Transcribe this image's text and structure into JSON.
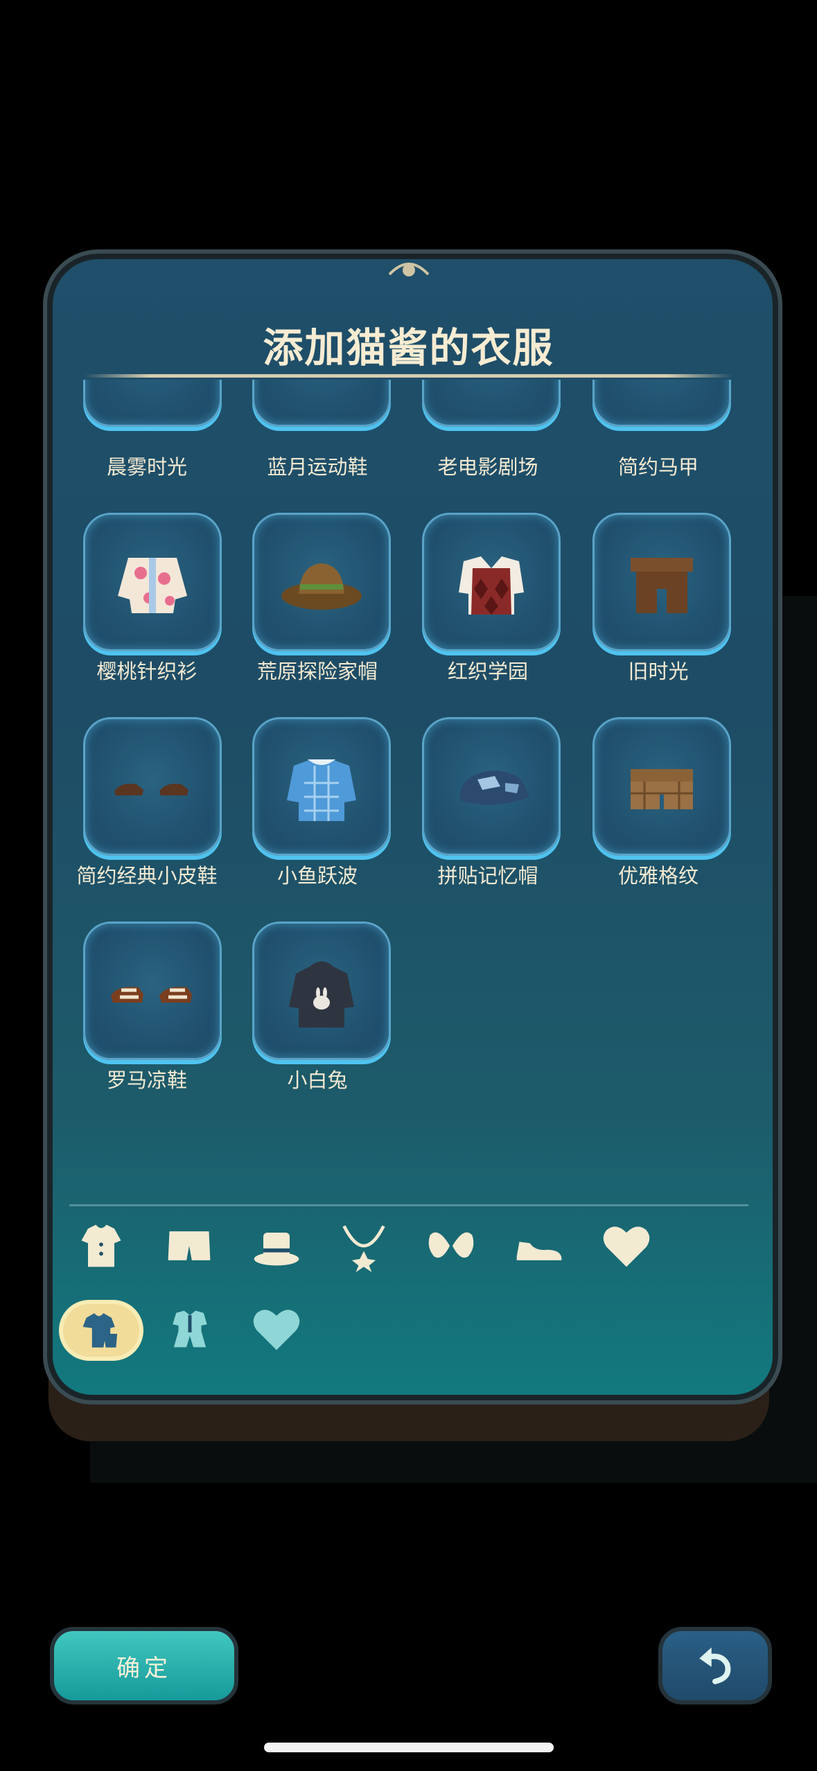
{
  "title": "添加猫酱的衣服",
  "colors": {
    "accent": "#4fc3f0",
    "panel": "#1f4f6a",
    "label": "#f3ead2",
    "icon": "#f3ead2",
    "active_tab": "#f1dc9a"
  },
  "items": [
    {
      "label": "晨雾时光",
      "icon": "partial-item-icon"
    },
    {
      "label": "蓝月运动鞋",
      "icon": "partial-item-icon"
    },
    {
      "label": "老电影剧场",
      "icon": "partial-item-icon"
    },
    {
      "label": "简约马甲",
      "icon": "partial-item-icon"
    },
    {
      "label": "樱桃针织衫",
      "icon": "cherry-cardigan-icon"
    },
    {
      "label": "荒原探险家帽",
      "icon": "explorer-hat-icon"
    },
    {
      "label": "红织学园",
      "icon": "argyle-vest-icon"
    },
    {
      "label": "旧时光",
      "icon": "brown-overalls-icon"
    },
    {
      "label": "简约经典小皮鞋",
      "icon": "leather-shoes-icon"
    },
    {
      "label": "小鱼跃波",
      "icon": "blue-plaid-shirt-icon"
    },
    {
      "label": "拼贴记忆帽",
      "icon": "patchwork-cap-icon"
    },
    {
      "label": "优雅格纹",
      "icon": "plaid-shorts-icon"
    },
    {
      "label": "罗马凉鞋",
      "icon": "roman-sandals-icon"
    },
    {
      "label": "小白兔",
      "icon": "bunny-hoodie-icon"
    }
  ],
  "category_tabs": [
    "shirt-icon",
    "shorts-icon",
    "hat-icon",
    "necklace-icon",
    "bow-icon",
    "shoe-icon",
    "heart-icon"
  ],
  "sub_tabs": [
    "outfit-icon",
    "set-icon",
    "favorite-heart-icon"
  ],
  "buttons": {
    "confirm": "确定",
    "back_icon": "undo-arrow-icon"
  }
}
